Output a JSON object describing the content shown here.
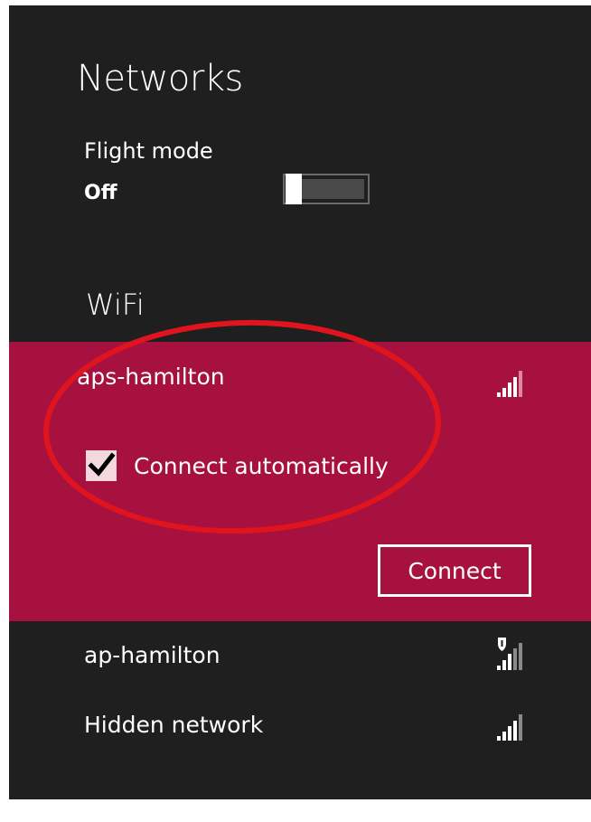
{
  "panel": {
    "title": "Networks"
  },
  "flight_mode": {
    "label": "Flight mode",
    "state": "Off"
  },
  "wifi": {
    "heading": "WiFi",
    "networks": [
      {
        "name": "aps-hamilton",
        "selected": true,
        "signal_icon": "signal-strength-icon",
        "connect_automatically": {
          "label": "Connect automatically",
          "checked": true
        },
        "connect_button": "Connect"
      },
      {
        "name": "ap-hamilton",
        "selected": false,
        "signal_icon": "secured-signal-strength-icon"
      },
      {
        "name": "Hidden network",
        "selected": false,
        "signal_icon": "signal-strength-icon"
      }
    ]
  },
  "colors": {
    "panel_background": "#1f1f1f",
    "selected_background": "#a6113f",
    "annotation_ring": "#e0141e"
  }
}
